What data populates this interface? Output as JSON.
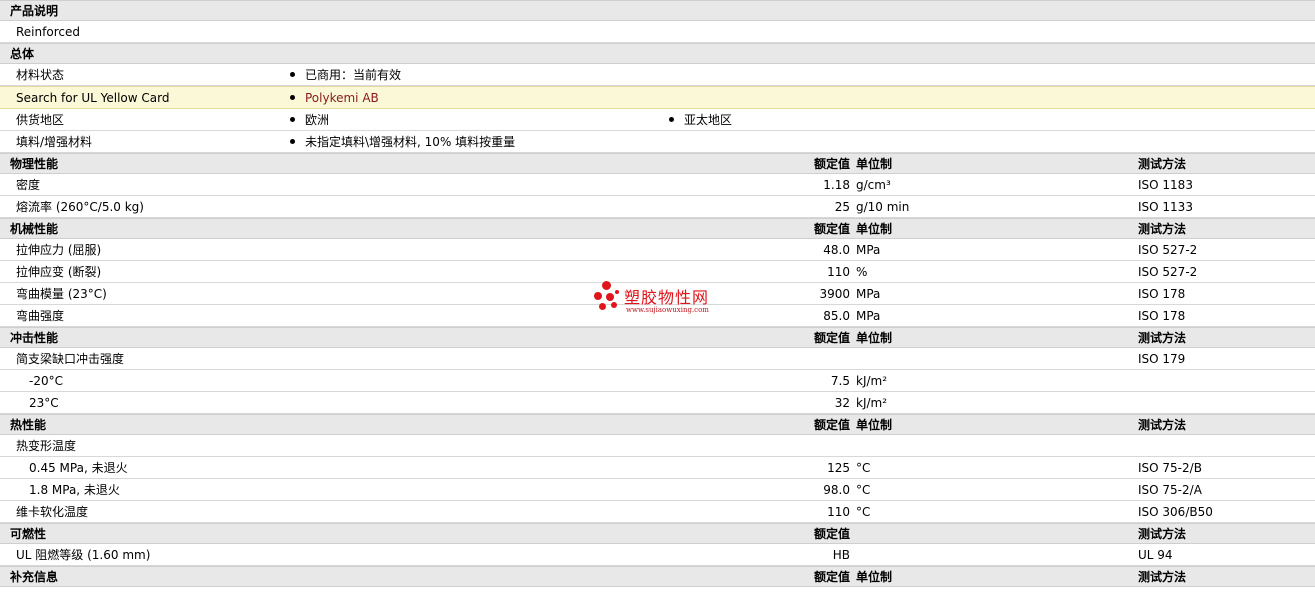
{
  "sections": {
    "desc": {
      "title": "产品说明",
      "text": "Reinforced"
    },
    "general": {
      "title": "总体",
      "status_label": "材料状态",
      "status_value": "已商用：当前有效",
      "ul_label": "Search for UL Yellow Card",
      "ul_value": "Polykemi AB",
      "supply_label": "供货地区",
      "supply_1": "欧洲",
      "supply_2": "亚太地区",
      "filler_label": "填料/增强材料",
      "filler_value": "未指定填料\\增强材料, 10% 填料按重量"
    },
    "physical": {
      "title": "物理性能",
      "h_val": "额定值",
      "h_unit": "单位制",
      "h_method": "测试方法",
      "rows": [
        {
          "label": "密度",
          "value": "1.18",
          "unit": "g/cm³",
          "method": "ISO 1183"
        },
        {
          "label": "熔流率 (260°C/5.0 kg)",
          "value": "25",
          "unit": "g/10 min",
          "method": "ISO 1133"
        }
      ]
    },
    "mechanical": {
      "title": "机械性能",
      "h_val": "额定值",
      "h_unit": "单位制",
      "h_method": "测试方法",
      "rows": [
        {
          "label": "拉伸应力 (屈服)",
          "value": "48.0",
          "unit": "MPa",
          "method": "ISO 527-2"
        },
        {
          "label": "拉伸应变 (断裂)",
          "value": "110",
          "unit": "%",
          "method": "ISO 527-2"
        },
        {
          "label": "弯曲模量 (23°C)",
          "value": "3900",
          "unit": "MPa",
          "method": "ISO 178"
        },
        {
          "label": "弯曲强度",
          "value": "85.0",
          "unit": "MPa",
          "method": "ISO 178"
        }
      ]
    },
    "impact": {
      "title": "冲击性能",
      "h_val": "额定值",
      "h_unit": "单位制",
      "h_method": "测试方法",
      "group_label": "简支梁缺口冲击强度",
      "group_method": "ISO 179",
      "rows": [
        {
          "label": "-20°C",
          "value": "7.5",
          "unit": "kJ/m²"
        },
        {
          "label": "23°C",
          "value": "32",
          "unit": "kJ/m²"
        }
      ]
    },
    "thermal": {
      "title": "热性能",
      "h_val": "额定值",
      "h_unit": "单位制",
      "h_method": "测试方法",
      "group_label": "热变形温度",
      "rows": [
        {
          "label": "0.45 MPa, 未退火",
          "value": "125",
          "unit": "°C",
          "method": "ISO 75-2/B"
        },
        {
          "label": "1.8 MPa, 未退火",
          "value": "98.0",
          "unit": "°C",
          "method": "ISO 75-2/A"
        }
      ],
      "vicat": {
        "label": "维卡软化温度",
        "value": "110",
        "unit": "°C",
        "method": "ISO 306/B50"
      }
    },
    "flammability": {
      "title": "可燃性",
      "h_val": "额定值",
      "h_method": "测试方法",
      "row": {
        "label": "UL 阻燃等级 (1.60 mm)",
        "value": "HB",
        "method": "UL 94"
      }
    },
    "supplement": {
      "title": "补充信息",
      "h_val": "额定值",
      "h_unit": "单位制",
      "h_method": "测试方法"
    }
  },
  "watermark": {
    "name": "塑胶物性网",
    "url": "www.sujiaowuxing.com"
  }
}
